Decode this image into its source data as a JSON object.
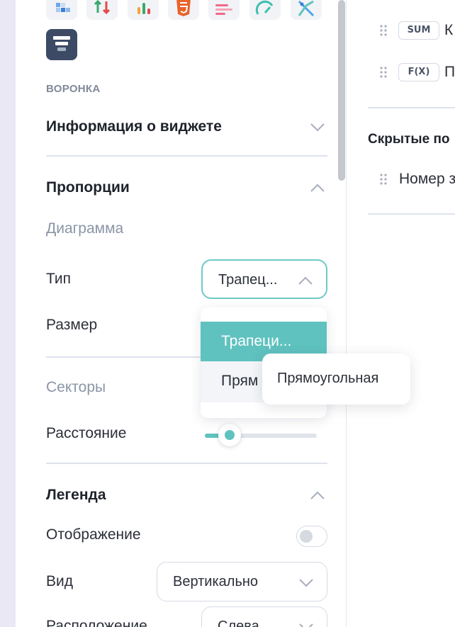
{
  "widgets": {
    "icons": [
      "heatmap-widget-icon",
      "exchange-arrows-widget-icon",
      "kpi-bars-widget-icon",
      "html5-widget-icon",
      "text-lines-widget-icon",
      "gauge-widget-icon",
      "scatter-widget-icon"
    ],
    "funnel_icon": "funnel-widget-icon"
  },
  "section_caption": "ВОРОНКА",
  "widget_info": {
    "title": "Информация о виджете"
  },
  "proportions": {
    "title": "Пропорции",
    "diagram_subtitle": "Диаграмма",
    "type_label": "Тип",
    "type_value": "Трапец...",
    "size_label": "Размер",
    "sectors_subtitle": "Секторы",
    "distance_label": "Расстояние",
    "distance_value": 0.22
  },
  "type_dropdown": {
    "options": [
      "Трапеци...",
      "Прям"
    ],
    "selected_index": 0
  },
  "tooltip": {
    "text": "Прямоугольная"
  },
  "legend": {
    "title": "Легенда",
    "display_label": "Отображение",
    "display_on": false,
    "view_label": "Вид",
    "view_value": "Вертикально",
    "position_label": "Расположение",
    "position_value": "Слева"
  },
  "fields": {
    "items": [
      {
        "tag": "SUM",
        "label": "К"
      },
      {
        "tag": "F(X)",
        "label": "П"
      }
    ],
    "hidden_title": "Скрытые по",
    "hidden_items": [
      {
        "label": "Номер з"
      }
    ]
  },
  "colors": {
    "accent": "#5fc2bf",
    "border": "#d5dae2",
    "sidebar": "#ebe8f5"
  }
}
